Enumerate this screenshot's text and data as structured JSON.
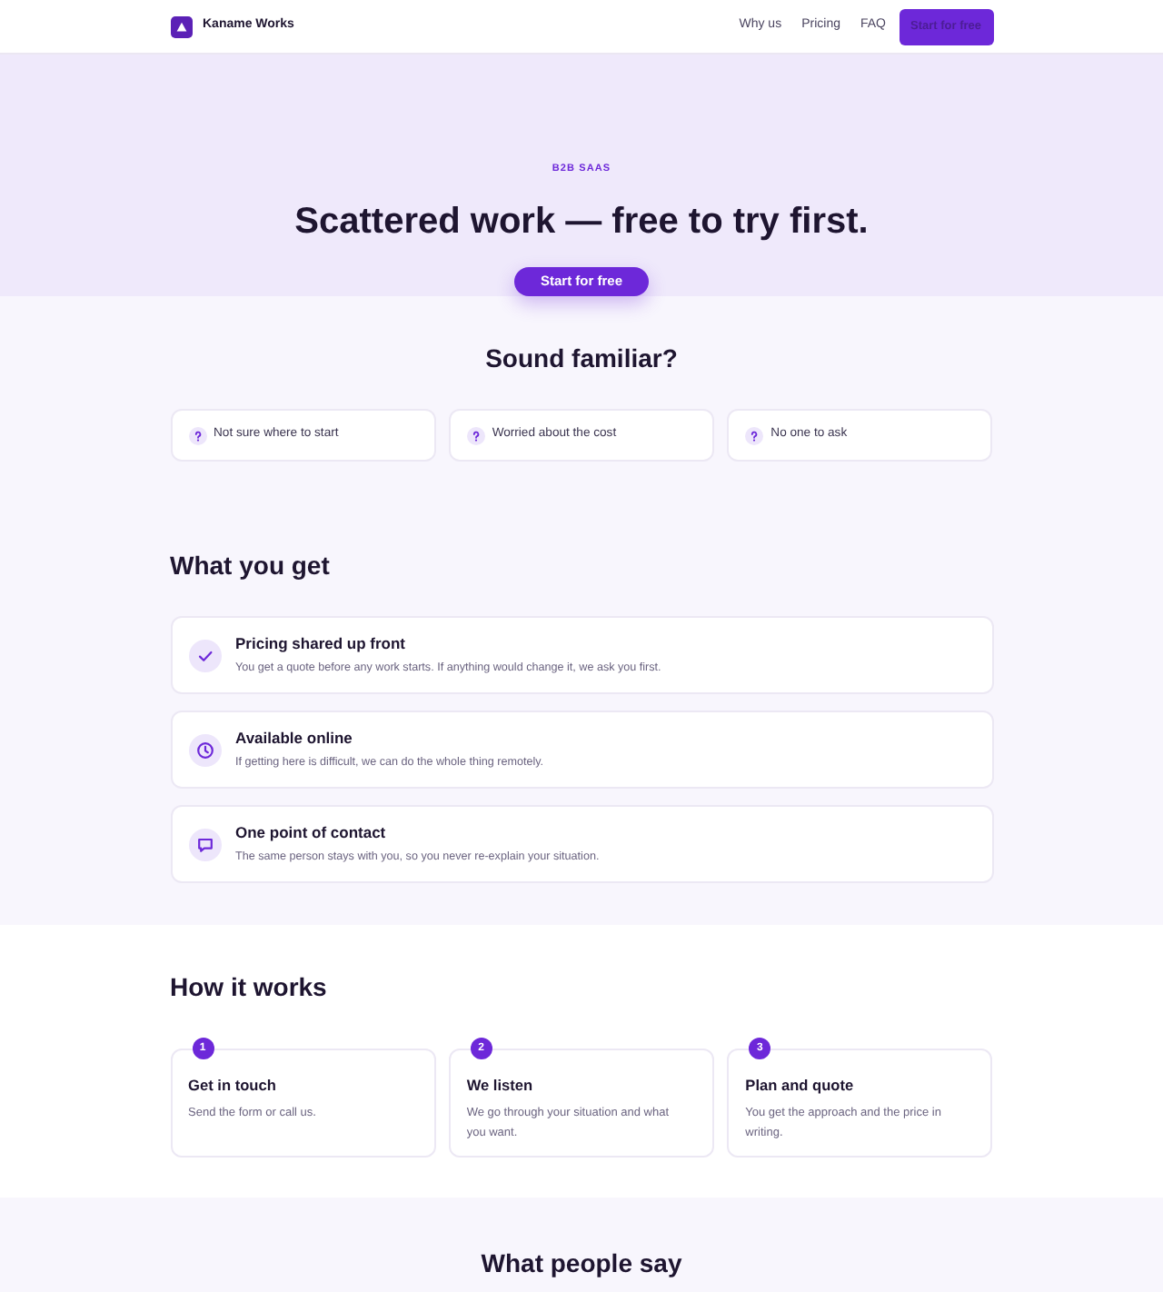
{
  "header": {
    "brand": "Kaname Works",
    "nav": [
      "Why us",
      "Pricing",
      "FAQ"
    ],
    "cta": "Start for free"
  },
  "hero": {
    "eyebrow": "B2B SAAS",
    "headline": "Scattered work — free to try first.",
    "cta": "Start for free"
  },
  "pain_points": {
    "title": "Sound familiar?",
    "items": [
      "Not sure where to start",
      "Worried about the cost",
      "No one to ask"
    ]
  },
  "benefits": {
    "title": "What you get",
    "items": [
      {
        "title": "Pricing shared up front",
        "text": "You get a quote before any work starts. If anything would change it, we ask you first."
      },
      {
        "title": "Available online",
        "text": "If getting here is difficult, we can do the whole thing remotely."
      },
      {
        "title": "One point of contact",
        "text": "The same person stays with you, so you never re-explain your situation."
      }
    ]
  },
  "steps": {
    "title": "How it works",
    "items": [
      {
        "number": "1",
        "title": "Get in touch",
        "text": "Send the form or call us."
      },
      {
        "number": "2",
        "title": "We listen",
        "text": "We go through your situation and what you want."
      },
      {
        "number": "3",
        "title": "Plan and quote",
        "text": "You get the approach and the price in writing."
      }
    ]
  },
  "testimonials": {
    "title": "What people say"
  }
}
